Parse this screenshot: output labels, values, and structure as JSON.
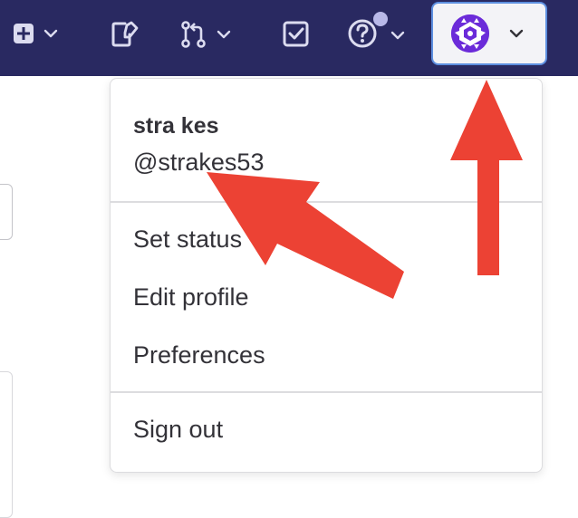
{
  "colors": {
    "navbar": "#292961",
    "avatar": "#6b2bd9",
    "arrow": "#ec4234",
    "notification_dot": "#b8b8e8"
  },
  "navbar": {
    "icons": [
      "plus-square-icon",
      "issues-icon",
      "merge-request-icon",
      "todo-icon",
      "help-icon"
    ]
  },
  "user_menu": {
    "name": "stra kes",
    "username": "@strakes53",
    "items": [
      {
        "label": "Set status"
      },
      {
        "label": "Edit profile"
      },
      {
        "label": "Preferences"
      }
    ],
    "sign_out": "Sign out"
  }
}
